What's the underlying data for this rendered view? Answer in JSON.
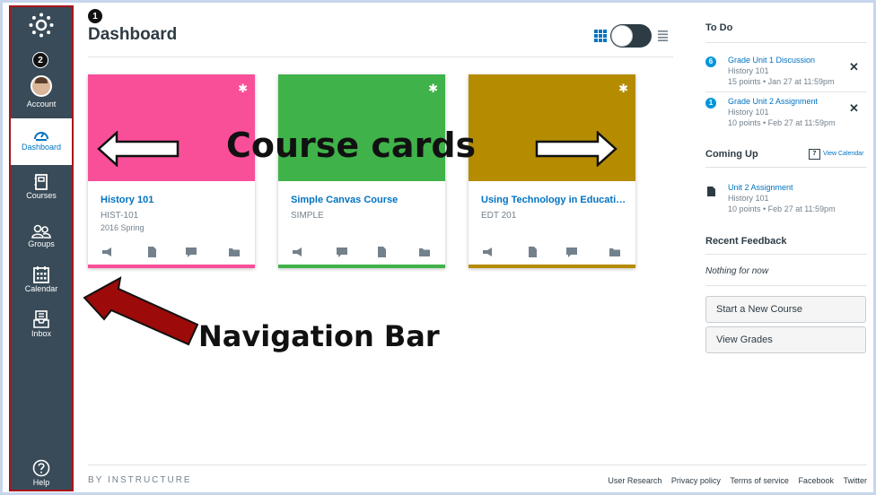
{
  "app": {
    "page_title": "Dashboard",
    "brand": "BY INSTRUCTURE",
    "accent": "#0073c2",
    "nav_bg": "#394b58"
  },
  "badges": {
    "one": "1",
    "two": "2"
  },
  "nav": {
    "items": [
      {
        "label": "Account",
        "icon": "avatar"
      },
      {
        "label": "Dashboard",
        "icon": "dashboard-gauge-icon"
      },
      {
        "label": "Courses",
        "icon": "courses-book-icon"
      },
      {
        "label": "Groups",
        "icon": "groups-people-icon"
      },
      {
        "label": "Calendar",
        "icon": "calendar-icon"
      },
      {
        "label": "Inbox",
        "icon": "inbox-tray-icon"
      },
      {
        "label": "Help",
        "icon": "help-question-icon"
      }
    ]
  },
  "courses": [
    {
      "name": "History 101",
      "code": "HIST-101",
      "term": "2016 Spring",
      "color": "#f94f99"
    },
    {
      "name": "Simple Canvas Course",
      "code": "SIMPLE",
      "term": "",
      "color": "#3fb24a"
    },
    {
      "name": "Using Technology in Education",
      "code": "EDT 201",
      "term": "",
      "color": "#b58b00"
    }
  ],
  "annotations": {
    "cards_label": "Course cards",
    "nav_label": "Navigation Bar"
  },
  "sidebar": {
    "todo_title": "To Do",
    "todo": [
      {
        "badge": "6",
        "title": "Grade Unit 1 Discussion",
        "course": "History 101",
        "meta": "15 points • Jan 27 at 11:59pm"
      },
      {
        "badge": "1",
        "title": "Grade Unit 2 Assignment",
        "course": "History 101",
        "meta": "10 points • Feb 27 at 11:59pm"
      }
    ],
    "coming_up_title": "Coming Up",
    "view_calendar": "View Calendar",
    "calendar_day": "7",
    "coming_up": [
      {
        "title": "Unit 2 Assignment",
        "course": "History 101",
        "meta": "10 points • Feb 27 at 11:59pm"
      }
    ],
    "feedback_title": "Recent Feedback",
    "feedback_empty": "Nothing for now",
    "start_course": "Start a New Course",
    "view_grades": "View Grades"
  },
  "footer": {
    "links": [
      "User Research",
      "Privacy policy",
      "Terms of service",
      "Facebook",
      "Twitter"
    ]
  }
}
